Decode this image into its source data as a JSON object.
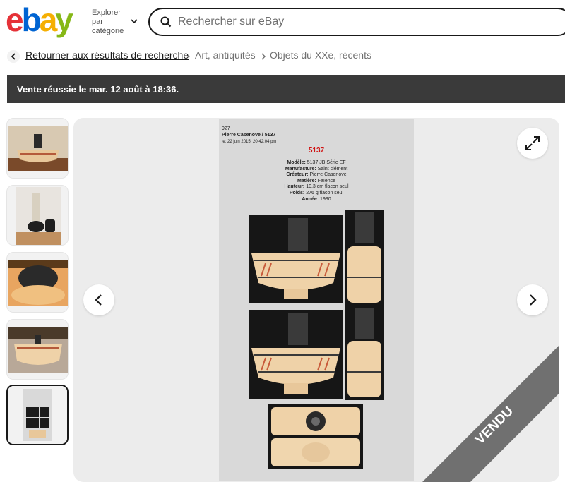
{
  "header": {
    "logo_letters": [
      "e",
      "b",
      "a",
      "y"
    ],
    "logo_colors": [
      "#e53238",
      "#0064d2",
      "#f5af02",
      "#86b817"
    ],
    "explore": [
      "Explorer",
      "par",
      "catégorie"
    ],
    "search_placeholder": "Rechercher sur eBay"
  },
  "breadcrumb": {
    "back_label": "Retourner aux résultats de recherche",
    "items": [
      "Art, antiquités",
      "Objets du XXe, récents"
    ]
  },
  "banner": {
    "text": "Vente réussie le mar. 12 août à 18:36."
  },
  "thumbnails": [
    {
      "name": "thumb-1"
    },
    {
      "name": "thumb-2"
    },
    {
      "name": "thumb-3"
    },
    {
      "name": "thumb-4"
    },
    {
      "name": "thumb-5"
    }
  ],
  "document": {
    "id": "927",
    "title": "Pierre Casenove / 5137",
    "date_label": "le:",
    "date": "22 juin 2015, 20:42:04 pm",
    "model_number": "5137",
    "specs": [
      {
        "label": "Modèle:",
        "value": "5137 JB Série EF"
      },
      {
        "label": "Manufacture:",
        "value": "Saint clément"
      },
      {
        "label": "Créateur:",
        "value": "Pierre Casenove"
      },
      {
        "label": "Matière:",
        "value": "Faïence"
      },
      {
        "label": "Hauteur:",
        "value": "10,3 cm flacon seul"
      },
      {
        "label": "Poids:",
        "value": "276 g flacon seul"
      },
      {
        "label": "Année:",
        "value": "1990"
      }
    ]
  },
  "sold_ribbon": "VENDU",
  "icons": {
    "back": "chevron-left-icon",
    "separator": "chevron-right-icon",
    "search": "search-icon",
    "expand": "expand-icon",
    "prev": "chevron-left-icon",
    "next": "chevron-right-icon"
  }
}
